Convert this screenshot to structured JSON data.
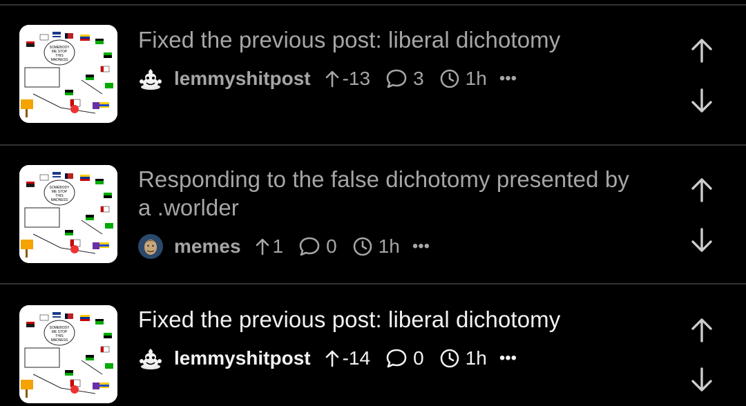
{
  "colors": {
    "background": "#000000",
    "divider": "#333333",
    "read_text": "#a6a6a6",
    "unread_text": "#f2f2f2",
    "icon": "#cccccc"
  },
  "posts": [
    {
      "title": "Fixed the previous post: liberal dichotomy",
      "read": true,
      "community": "lemmyshitpost",
      "community_icon": "poop-mascot-icon",
      "score": "-13",
      "comments": "3",
      "time": "1h",
      "more": "•••"
    },
    {
      "title": "Responding to the false dichotomy presented by a .worlder",
      "read": true,
      "community": "memes",
      "community_icon": "meme-face-icon",
      "score": "1",
      "comments": "0",
      "time": "1h",
      "more": "•••"
    },
    {
      "title": "Fixed the previous post: liberal dichotomy",
      "read": false,
      "community": "lemmyshitpost",
      "community_icon": "poop-mascot-icon",
      "score": "-14",
      "comments": "0",
      "time": "1h",
      "more": "•••"
    }
  ],
  "thumbnail_text": [
    "SOMEBODY",
    "ME STOP",
    "THIS",
    "MADNESS"
  ]
}
